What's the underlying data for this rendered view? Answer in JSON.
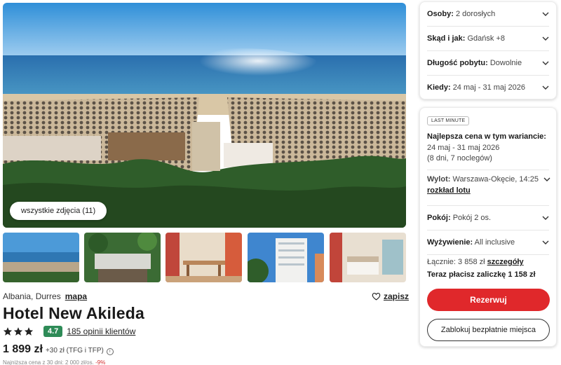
{
  "gallery": {
    "all_photos_label": "wszystkie zdjęcia (11)",
    "thumbnails": [
      "beach-aerial",
      "hotel-garden",
      "restaurant",
      "hotel-tower",
      "hotel-room"
    ]
  },
  "hotel": {
    "country_city": "Albania, Durres",
    "map_label": "mapa",
    "save_label": "zapisz",
    "name": "Hotel New Akileda",
    "stars": 3,
    "score": "4.7",
    "reviews_label": "185 opinii klientów",
    "price": "1 899 zł",
    "price_extra": "+30 zł (TFG i TFP)",
    "cut_text": "Najniższa cena z 30 dni: 2 000 zł/os.",
    "cut_pct": "-9%"
  },
  "search": {
    "persons_label": "Osoby:",
    "persons_value": "2 dorosłych",
    "from_label": "Skąd i jak:",
    "from_value": "Gdańsk +8",
    "duration_label": "Długość pobytu:",
    "duration_value": "Dowolnie",
    "when_label": "Kiedy:",
    "when_value": "24 maj - 31 maj 2026"
  },
  "offer": {
    "badge": "LAST MINUTE",
    "best_price_label": "Najlepsza cena w tym wariancie:",
    "dates": "24 maj - 31 maj 2026",
    "nights": "(8 dni, 7 noclegów)",
    "flight_label": "Wylot:",
    "flight_value": "Warszawa-Okęcie, 14:25",
    "flight_link": "rozkład lotu",
    "room_label": "Pokój:",
    "room_value": "Pokój 2 os.",
    "board_label": "Wyżywienie:",
    "board_value": "All inclusive",
    "total_label": "Łącznie:",
    "total_value": "3 858 zł",
    "details_link": "szczegóły",
    "deposit_text": "Teraz płacisz zaliczkę 1 158 zł",
    "reserve_label": "Rezerwuj",
    "block_label": "Zablokuj bezpłatnie miejsca"
  },
  "colors": {
    "accent_red": "#e0282b",
    "score_green": "#2e8b57"
  }
}
